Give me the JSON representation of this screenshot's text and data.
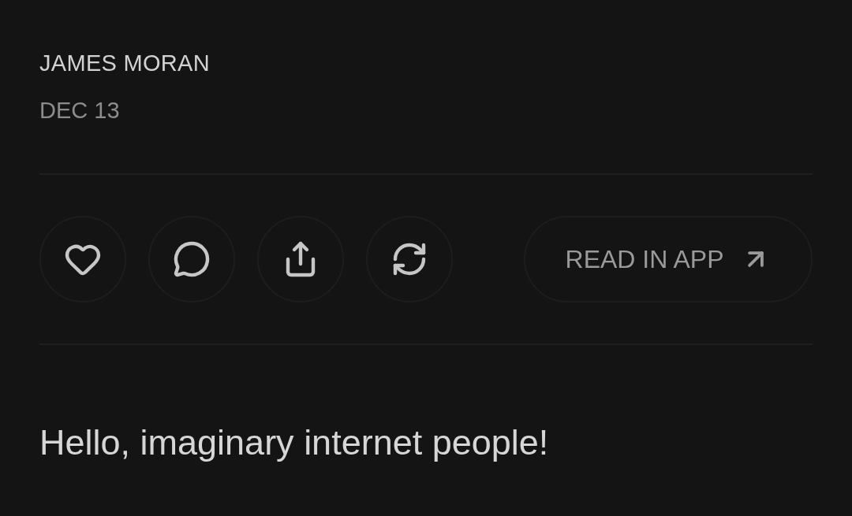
{
  "post": {
    "author": "JAMES MORAN",
    "date": "DEC 13"
  },
  "actions": [
    {
      "kind": "like"
    },
    {
      "kind": "comment"
    },
    {
      "kind": "share"
    },
    {
      "kind": "restack"
    }
  ],
  "read_button": {
    "label": "READ IN APP"
  },
  "body": "Hello, imaginary internet people!"
}
